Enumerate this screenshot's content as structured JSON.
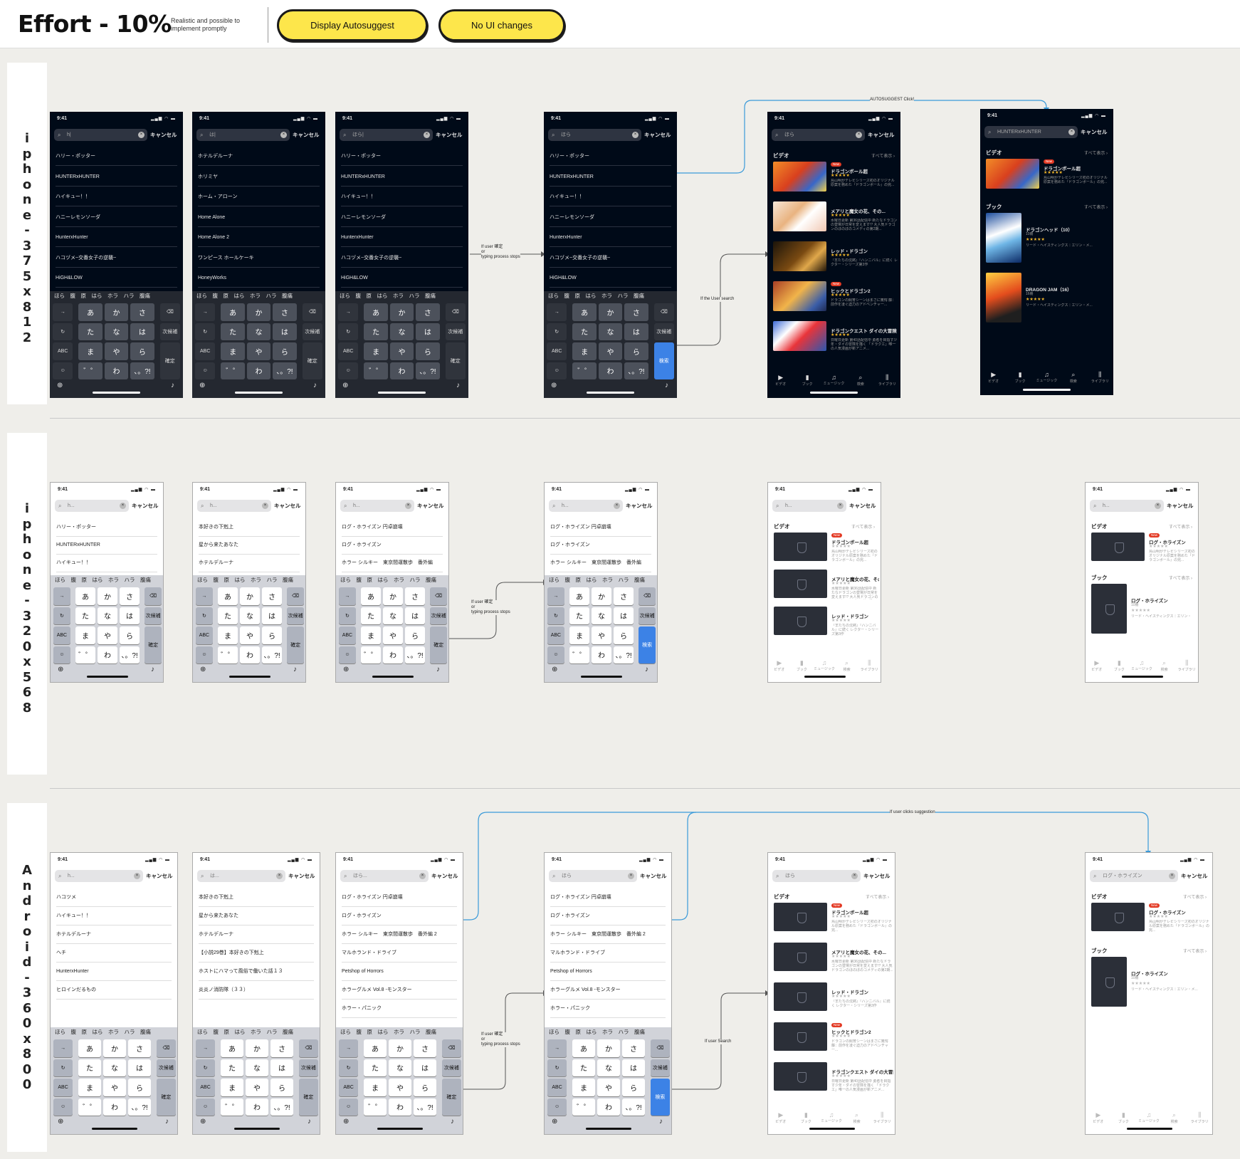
{
  "header": {
    "title": "Effort - 10%",
    "subtitle": "Realistic and possible to implement promptly",
    "tags": [
      "Display Autosuggest",
      "No UI changes"
    ]
  },
  "rows": [
    {
      "label": "iphone-375x812"
    },
    {
      "label": "iphone-320x568"
    },
    {
      "label": "Android-360x800"
    }
  ],
  "flow_labels": {
    "autosuggest_click": "AUTOSUGGEST Click!",
    "user_stops_1": "If user 確定\nor\ntyping process stops",
    "user_search_1": "If the User search",
    "user_stops_2": "If user 確定\nor\ntyping process stops",
    "clicks_suggestion": "If user clicks suggestion",
    "user_stops_3": "If user 確定\nor\ntyping process stops",
    "user_search_3": "If user Search"
  },
  "common": {
    "time": "9:41",
    "status_icons": "▂▄▆ ◠ ▬",
    "cancel": "キャンセル",
    "predictions": "ほら　腹　原　はら　ホラ　ハラ　腹痛",
    "keys": {
      "r1": [
        "→",
        "あ",
        "か",
        "さ",
        "⌫"
      ],
      "r2": [
        "↻",
        "た",
        "な",
        "は",
        "次候補"
      ],
      "r3": [
        "ABC",
        "ま",
        "や",
        "ら",
        "確定"
      ],
      "r4": [
        "☺",
        "゛゜",
        "わ",
        "、。?!"
      ],
      "search": "検索"
    },
    "section_video": "ビデオ",
    "section_book": "ブック",
    "see_all": "すべて表示 ›",
    "new_badge": "New",
    "tabs": [
      "ビデオ",
      "ブック",
      "ミュージック",
      "検索",
      "ライブラリ"
    ]
  },
  "queries": {
    "h": "h|",
    "ha": "は|",
    "hora": "ほら|",
    "hora_done": "ほら",
    "hunter": "HUNTERxHUNTER",
    "log": "ログ・ホライズン",
    "h_small": "h...",
    "ha_small": "は...",
    "hora_small": "ほら..."
  },
  "lists": {
    "h": [
      "ハリー・ポッター",
      "HUNTERxHUNTER",
      "ハイキュー！！",
      "ハニーレモンソーダ",
      "HunterxHunter",
      "ハコヅメ~交番女子の逆襲~",
      "HiGH&LOW"
    ],
    "ha": [
      "ホテルデルーナ",
      "ホリミヤ",
      "ホーム・アローン",
      "Home Alone",
      "Home Alone 2",
      "ワンピース ホールケーキ",
      "HoneyWorks"
    ],
    "hora": [
      "ハリー・ポッター",
      "HUNTERxHUNTER",
      "ハイキュー！！",
      "ハニーレモンソーダ",
      "HunterxHunter",
      "ハコヅメ~交番女子の逆襲~",
      "HiGH&LOW"
    ],
    "small_h": [
      "ハリー・ポッター",
      "HUNTERxHUNTER",
      "ハイキュー！！"
    ],
    "small_ha": [
      "本好きの下剋上",
      "星から来たあなた",
      "ホテルデルーナ"
    ],
    "small_hora": [
      "ログ・ホライズン 円卓崩壊",
      "ログ・ホライズン",
      "ホラー シルキー　東京間運散歩　番外編"
    ],
    "and_h": [
      "ハコツメ",
      "ハイキュー！！",
      "ホテルデルーナ",
      "ヘチ",
      "HunterxHunter",
      "ヒロインだるもの"
    ],
    "and_ha": [
      "本好きの下剋上",
      "星から来たあなた",
      "ホテルデルーナ",
      "【小説29巻】本好きの下剋上",
      "ホストにハマって風俗で働いた話１３",
      "炎炎ノ消防隊（３３）"
    ],
    "and_hora": [
      "ログ・ホライズン 円卓崩壊",
      "ログ・ホライズン",
      "ホラー シルキー　東京間運散歩　番外編 2",
      "マルホランド・ドライブ",
      "Petshop of Horrors",
      "ホラーグルメ Vol.8 -モンスター",
      "ホラー・パニック"
    ]
  },
  "results": {
    "videos": [
      {
        "title": "ドラゴンボール超",
        "desc": "鳥山明がテレビシリーズ初のオリジナル原案を務めた『ドラゴンボール』の完..."
      },
      {
        "title": "メアリと魔女の花、その...",
        "desc": "水曜日更新 第36話配信中\n新たなドラゴンの登場が日常を変えます!?\n大人気ドラゴンのほのぼのコメディの第2期..."
      },
      {
        "title": "レッド・ドラゴン",
        "desc": "『羊たちの沈黙』『ハンニバル』に続く\nレクター・シリーズ第3作"
      },
      {
        "title": "ヒックとドラゴン2",
        "desc": "ドラゴンの飼育シーンはまさに驚愕\n藤：前作を凌ぐ迫力のアドベンチャー..."
      },
      {
        "title": "ドラゴンクエスト ダイの大冒険",
        "desc": "日曜日更新 第40話配信中\n勇者を目指す少年・ダイの冒険を描く\n「ドラクエ」唯一の人気漫画が新アニメ..."
      }
    ],
    "hunter_video": {
      "title": "ドラゴンボール超",
      "desc": "鳥山明がテレビシリーズ初のオリジナル原案を務めた『ドラゴンボール』の完..."
    },
    "books": [
      {
        "title": "ドラゴンヘッド（10）",
        "meta": "10冊",
        "desc": "リード・ヘイスティングス｜エリン・メ..."
      },
      {
        "title": "DRAGON JAM（16）",
        "meta": "16冊",
        "desc": "リード・ヘイスティングス｜エリン・メ..."
      }
    ],
    "log_video": {
      "title": "ログ・ホライズン",
      "desc": "鳥山明がテレビシリーズ初のオリジナル原案を務めた『ドラゴンボール』の完..."
    },
    "log_book": {
      "title": "ログ・ホライズン",
      "meta": "10冊",
      "desc": "リード・ヘイスティングス｜エリン・メ..."
    }
  }
}
